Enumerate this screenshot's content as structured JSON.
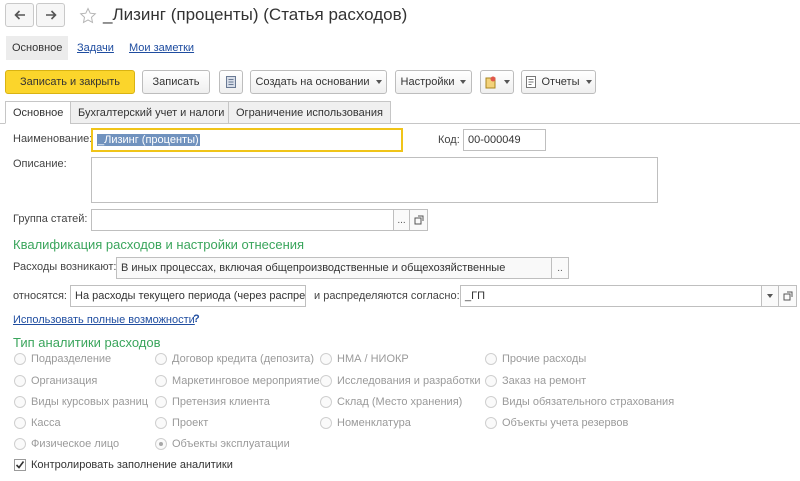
{
  "window": {
    "title": "_Лизинг (проценты) (Статья расходов)"
  },
  "sections": [
    {
      "label": "Основное"
    },
    {
      "label": "Задачи"
    },
    {
      "label": "Мои заметки"
    }
  ],
  "toolbar": {
    "save_close": "Записать и закрыть",
    "save": "Записать",
    "create_based": "Создать на основании",
    "settings": "Настройки",
    "reports": "Отчеты"
  },
  "tabs": [
    {
      "label": "Основное"
    },
    {
      "label": "Бухгалтерский учет и налоги"
    },
    {
      "label": "Ограничение использования"
    }
  ],
  "form": {
    "name_label": "Наименование:",
    "name_value": "_Лизинг (проценты)",
    "code_label": "Код:",
    "code_value": "00-000049",
    "description_label": "Описание:",
    "description_value": "",
    "group_label": "Группа статей:",
    "group_value": "",
    "group_more": "...",
    "qualification_header": "Квалификация расходов и настройки отнесения",
    "arises_label": "Расходы возникают:",
    "arises_value": "В иных процессах, включая общепроизводственные и общехозяйственные",
    "arises_more": "..",
    "relate_label": "относятся:",
    "relate_value": "На расходы текущего периода (через распреде",
    "distribute_label": "и распределяются согласно:",
    "distribute_value": "_ГП",
    "full_link": "Использовать полные возможности",
    "help": "?",
    "analytics_header": "Тип аналитики расходов",
    "control_label": "Контролировать заполнение аналитики",
    "control_checked": true
  },
  "analytics": [
    [
      "Подразделение",
      "Договор кредита (депозита)",
      "НМА / НИОКР",
      "Прочие расходы"
    ],
    [
      "Организация",
      "Маркетинговое мероприятие",
      "Исследования и разработки",
      "Заказ на ремонт"
    ],
    [
      "Виды курсовых разниц",
      "Претензия клиента",
      "Склад (Место хранения)",
      "Виды обязательного страхования"
    ],
    [
      "Касса",
      "Проект",
      "Номенклатура",
      "Объекты учета резервов"
    ],
    [
      "Физическое лицо",
      "Объекты эксплуатации"
    ]
  ],
  "analytics_selected": "Объекты эксплуатации",
  "colors": {
    "accent": "#fbd52b",
    "header_green": "#3aa55c",
    "link": "#1f4da0",
    "selection": "#7092be"
  }
}
